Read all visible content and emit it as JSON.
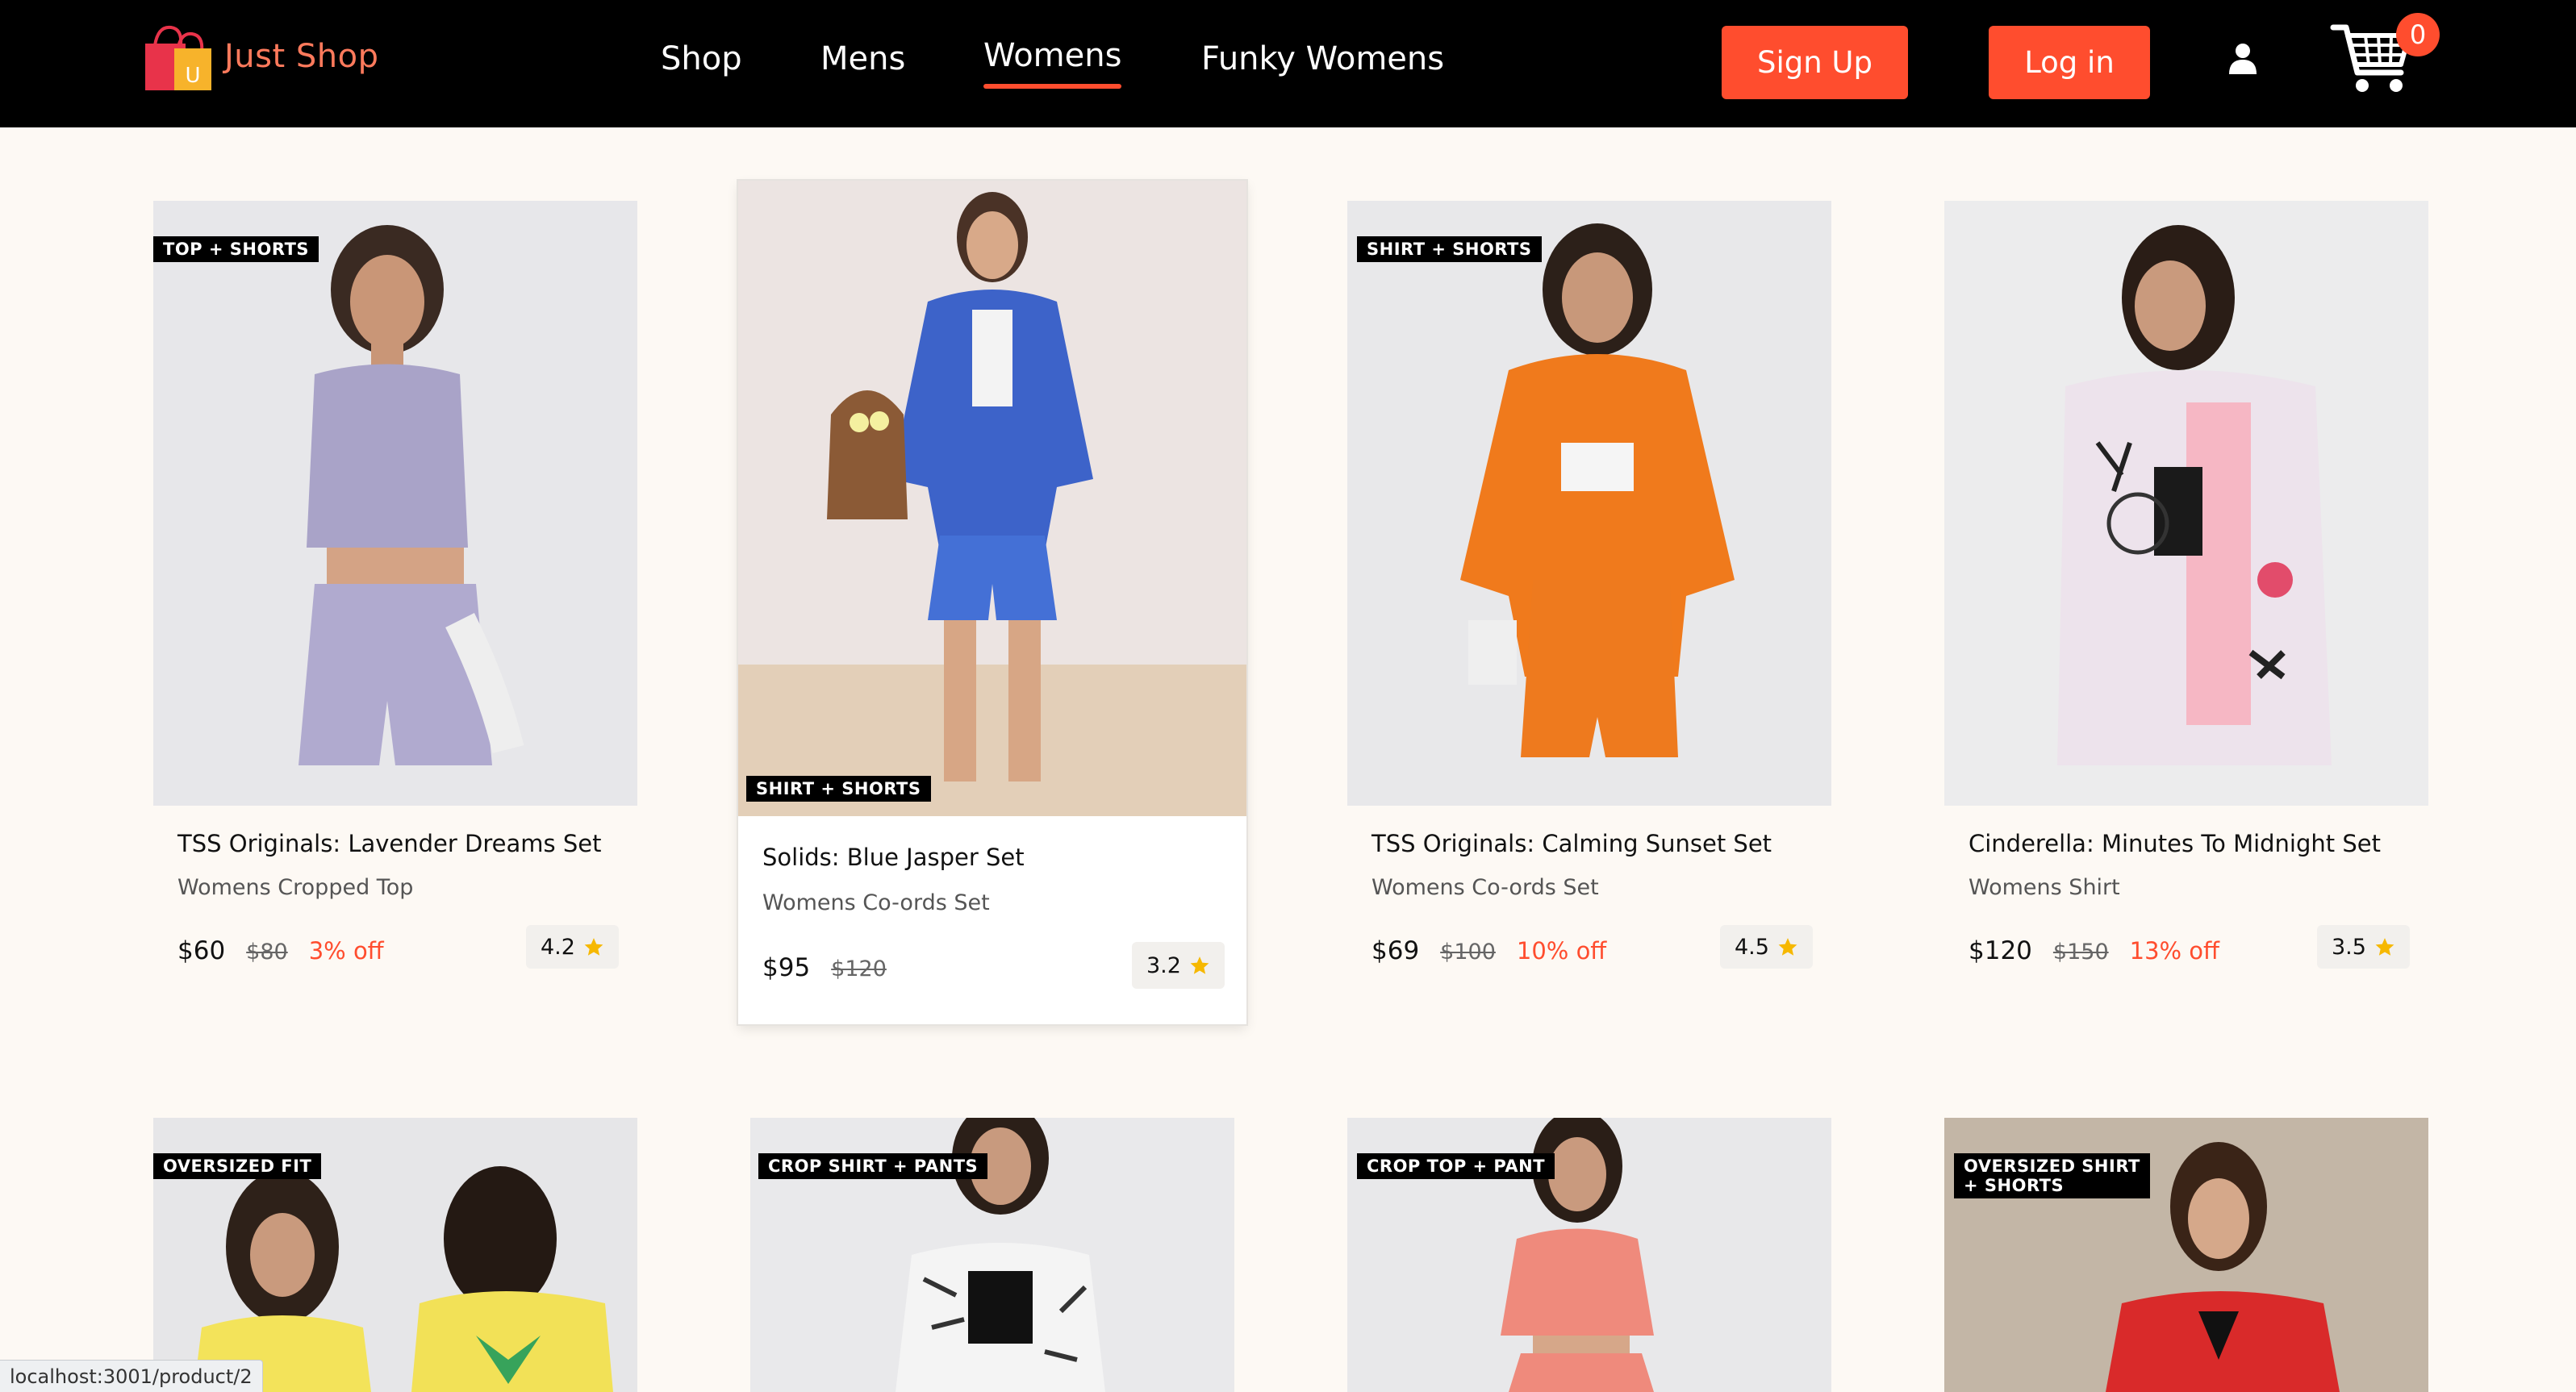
{
  "brand": {
    "name": "Just Shop",
    "logo_letter": "U"
  },
  "nav": {
    "links": [
      "Shop",
      "Mens",
      "Womens",
      "Funky Womens"
    ],
    "active": "Womens",
    "signup_label": "Sign Up",
    "login_label": "Log in",
    "cart_count": "0"
  },
  "colors": {
    "accent": "#ff4d2e",
    "navbar": "#000000",
    "page_bg": "#fdf9f4",
    "star": "#f6b800"
  },
  "products": [
    {
      "tag": "TOP + SHORTS",
      "title": "TSS Originals: Lavender Dreams Set",
      "category": "Womens Cropped Top",
      "price": "$60",
      "mrp": "$80",
      "discount": "3% off",
      "rating": "4.2"
    },
    {
      "tag": "SHIRT + SHORTS",
      "title": "Solids: Blue Jasper Set",
      "category": "Womens Co-ords Set",
      "price": "$95",
      "mrp": "$120",
      "discount": "",
      "rating": "3.2"
    },
    {
      "tag": "SHIRT + SHORTS",
      "title": "TSS Originals: Calming Sunset Set",
      "category": "Womens Co-ords Set",
      "price": "$69",
      "mrp": "$100",
      "discount": "10% off",
      "rating": "4.5"
    },
    {
      "tag": "",
      "title": "Cinderella: Minutes To Midnight Set",
      "category": "Womens Shirt",
      "price": "$120",
      "mrp": "$150",
      "discount": "13% off",
      "rating": "3.5"
    },
    {
      "tag": "OVERSIZED FIT"
    },
    {
      "tag": "CROP SHIRT + PANTS"
    },
    {
      "tag": "CROP TOP + PANT"
    },
    {
      "tag": "OVERSIZED SHIRT\n+ SHORTS"
    }
  ],
  "status_bar": {
    "url": "localhost:3001/product/2"
  }
}
